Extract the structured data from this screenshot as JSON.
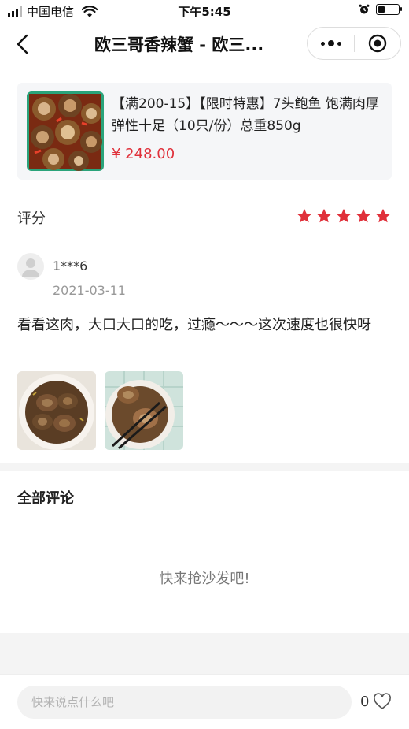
{
  "status_bar": {
    "carrier": "中国电信",
    "time": "下午5:45"
  },
  "nav": {
    "title": "欧三哥香辣蟹 - 欧三..."
  },
  "product": {
    "title": "【满200-15】【限时特惠】7头鲍鱼 饱满肉厚弹性十足（10只/份）总重850g",
    "price": "¥ 248.00"
  },
  "rating": {
    "label": "评分",
    "stars": 5,
    "star_color": "#e0303a"
  },
  "review": {
    "user": "1***6",
    "date": "2021-03-11",
    "text": "看看这肉，大口大口的吃，过瘾～～～这次速度也很快呀",
    "photo_count": 2
  },
  "all_comments": {
    "title": "全部评论",
    "empty_tip": "快来抢沙发吧!"
  },
  "bottom_bar": {
    "input_placeholder": "快来说点什么吧",
    "like_count": "0"
  }
}
